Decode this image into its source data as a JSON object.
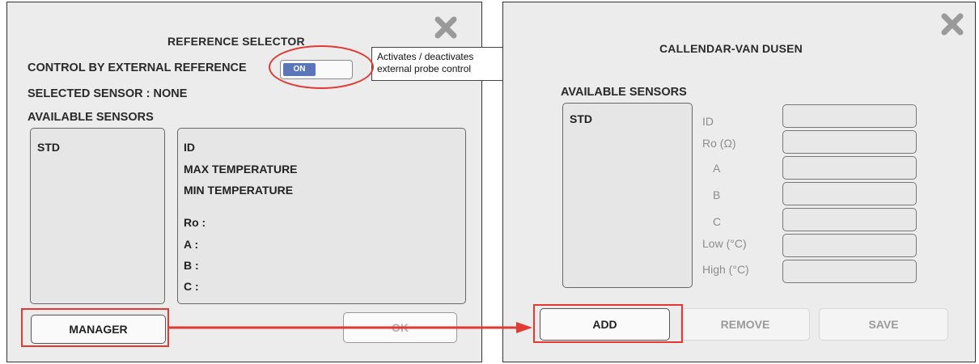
{
  "reference_selector": {
    "title": "REFERENCE SELECTOR",
    "control_label": "CONTROL BY EXTERNAL REFERENCE",
    "toggle_state": "ON",
    "selected_sensor_label": "SELECTED SENSOR : NONE",
    "available_sensors_label": "AVAILABLE SENSORS",
    "sensors": [
      "STD"
    ],
    "details": {
      "id": "ID",
      "max_temp": "MAX TEMPERATURE",
      "min_temp": "MIN TEMPERATURE",
      "ro": "Ro :",
      "a": "A :",
      "b": "B :",
      "c": "C :"
    },
    "manager_button": "MANAGER",
    "ok_button": "OK",
    "callout_line1": "Activates / deactivates",
    "callout_line2": "external probe control"
  },
  "callendar": {
    "title": "CALLENDAR-VAN DUSEN",
    "available_sensors_label": "AVAILABLE SENSORS",
    "sensors": [
      "STD"
    ],
    "fields": [
      {
        "label": "ID",
        "value": ""
      },
      {
        "label": "Ro (Ω)",
        "value": ""
      },
      {
        "label": "A",
        "value": ""
      },
      {
        "label": "B",
        "value": ""
      },
      {
        "label": "C",
        "value": ""
      },
      {
        "label": "Low (°C)",
        "value": ""
      },
      {
        "label": "High (°C)",
        "value": ""
      }
    ],
    "add_button": "ADD",
    "remove_button": "REMOVE",
    "save_button": "SAVE"
  },
  "colors": {
    "annotation": "#e03a32",
    "toggle_on": "#5a76b8",
    "panel_bg": "#ececec"
  }
}
